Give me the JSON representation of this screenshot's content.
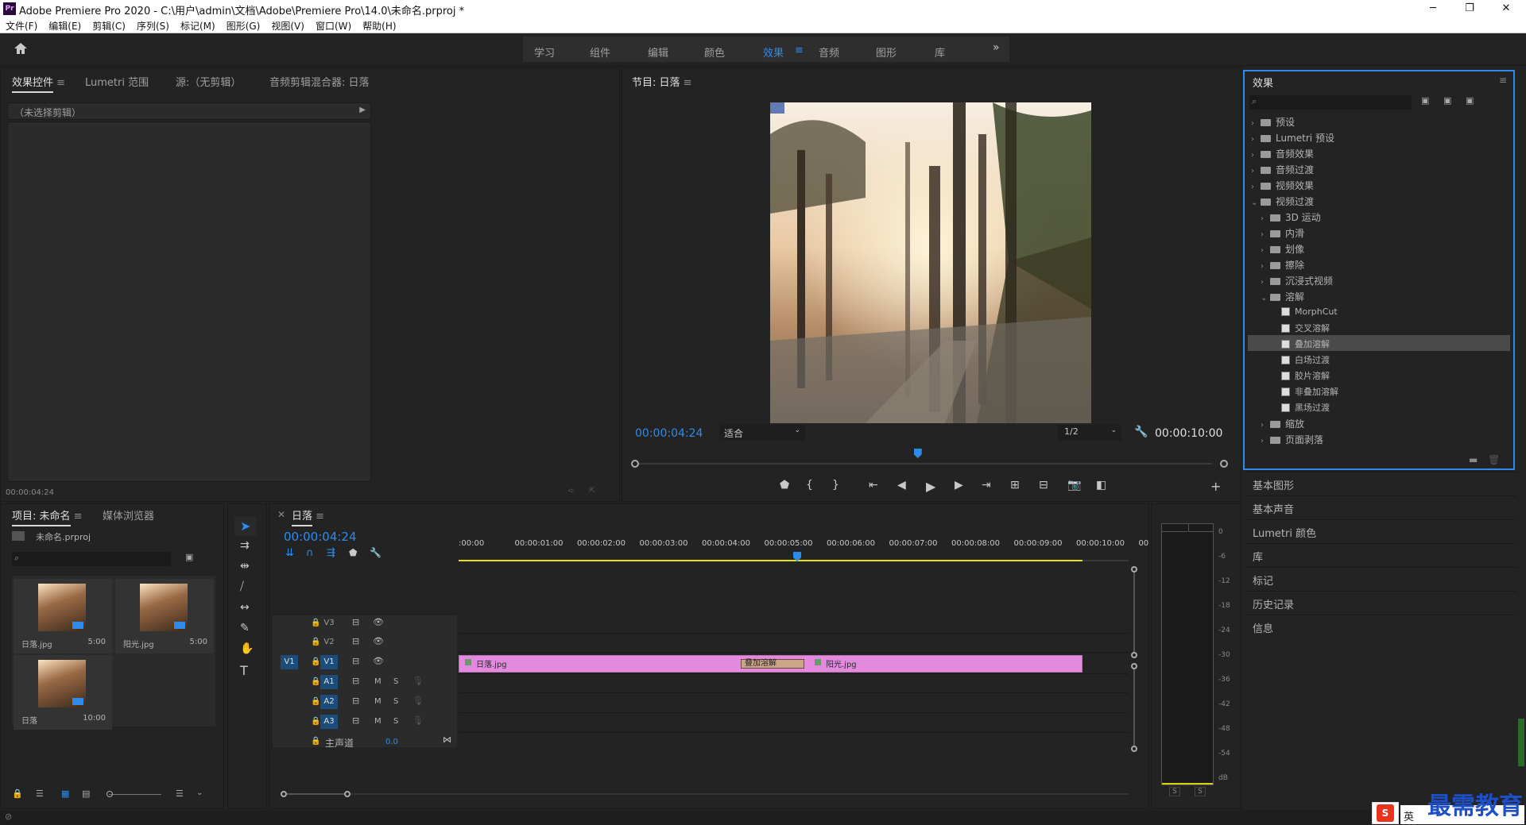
{
  "window": {
    "title": "Adobe Premiere Pro 2020 - C:\\用户\\admin\\文档\\Adobe\\Premiere Pro\\14.0\\未命名.prproj *",
    "app_icon": "Pr",
    "minimize": "─",
    "restore": "❐",
    "close": "✕"
  },
  "menu": [
    "文件(F)",
    "编辑(E)",
    "剪辑(C)",
    "序列(S)",
    "标记(M)",
    "图形(G)",
    "视图(V)",
    "窗口(W)",
    "帮助(H)"
  ],
  "workspaces": [
    "学习",
    "组件",
    "编辑",
    "颜色",
    "效果",
    "音频",
    "图形",
    "库"
  ],
  "workspace_active": "效果",
  "effect_controls": {
    "tabs": [
      "效果控件",
      "Lumetri 范围",
      "源:（无剪辑）",
      "音频剪辑混合器: 日落"
    ],
    "no_clip": "（未选择剪辑）",
    "timecode": "00:00:04:24"
  },
  "program": {
    "title": "节目: 日落",
    "timecode": "00:00:04:24",
    "fit": "适合",
    "resolution": "1/2",
    "duration": "00:00:10:00",
    "playhead_fraction": 0.49
  },
  "effects_panel": {
    "title": "效果",
    "tree": [
      {
        "label": "预设",
        "depth": 0,
        "type": "folder",
        "open": false
      },
      {
        "label": "Lumetri 预设",
        "depth": 0,
        "type": "folder",
        "open": false
      },
      {
        "label": "音频效果",
        "depth": 0,
        "type": "folder",
        "open": false
      },
      {
        "label": "音频过渡",
        "depth": 0,
        "type": "folder",
        "open": false
      },
      {
        "label": "视频效果",
        "depth": 0,
        "type": "folder",
        "open": false
      },
      {
        "label": "视频过渡",
        "depth": 0,
        "type": "folder",
        "open": true
      },
      {
        "label": "3D 运动",
        "depth": 1,
        "type": "folder",
        "open": false
      },
      {
        "label": "内滑",
        "depth": 1,
        "type": "folder",
        "open": false
      },
      {
        "label": "划像",
        "depth": 1,
        "type": "folder",
        "open": false
      },
      {
        "label": "擦除",
        "depth": 1,
        "type": "folder",
        "open": false
      },
      {
        "label": "沉浸式视频",
        "depth": 1,
        "type": "folder",
        "open": false
      },
      {
        "label": "溶解",
        "depth": 1,
        "type": "folder",
        "open": true
      },
      {
        "label": "MorphCut",
        "depth": 2,
        "type": "effect"
      },
      {
        "label": "交叉溶解",
        "depth": 2,
        "type": "effect"
      },
      {
        "label": "叠加溶解",
        "depth": 2,
        "type": "effect",
        "selected": true
      },
      {
        "label": "白场过渡",
        "depth": 2,
        "type": "effect"
      },
      {
        "label": "胶片溶解",
        "depth": 2,
        "type": "effect"
      },
      {
        "label": "非叠加溶解",
        "depth": 2,
        "type": "effect"
      },
      {
        "label": "黑场过渡",
        "depth": 2,
        "type": "effect"
      },
      {
        "label": "缩放",
        "depth": 1,
        "type": "folder",
        "open": false
      },
      {
        "label": "页面剥落",
        "depth": 1,
        "type": "folder",
        "open": false
      }
    ]
  },
  "side_panels": [
    "基本图形",
    "基本声音",
    "Lumetri 颜色",
    "库",
    "标记",
    "历史记录",
    "信息"
  ],
  "project": {
    "tabs": [
      "项目: 未命名",
      "媒体浏览器"
    ],
    "file": "未命名.prproj",
    "items": [
      {
        "name": "日落.jpg",
        "duration": "5:00"
      },
      {
        "name": "阳光.jpg",
        "duration": "5:00"
      },
      {
        "name": "日落",
        "duration": "10:00"
      }
    ]
  },
  "timeline": {
    "title": "日落",
    "timecode": "00:00:04:24",
    "ruler_labels": [
      ":00:00",
      "00:00:01:00",
      "00:00:02:00",
      "00:00:03:00",
      "00:00:04:00",
      "00:00:05:00",
      "00:00:06:00",
      "00:00:07:00",
      "00:00:08:00",
      "00:00:09:00",
      "00:00:10:00",
      "00"
    ],
    "video_tracks": [
      "V3",
      "V2",
      "V1"
    ],
    "audio_tracks": [
      "A1",
      "A2",
      "A3"
    ],
    "source_patch": "V1",
    "mute_label": "M",
    "solo_label": "S",
    "master_label": "主声道",
    "master_value": "0.0",
    "clip1": "日落.jpg",
    "clip2": "阳光.jpg",
    "transition": "叠加溶解"
  },
  "meter": {
    "ticks": [
      "0",
      "-6",
      "-12",
      "-18",
      "-24",
      "-30",
      "-36",
      "-42",
      "-48",
      "-54",
      "dB"
    ],
    "solo_left": "S",
    "solo_right": "S"
  },
  "watermark": "最需教育",
  "ime": "英"
}
